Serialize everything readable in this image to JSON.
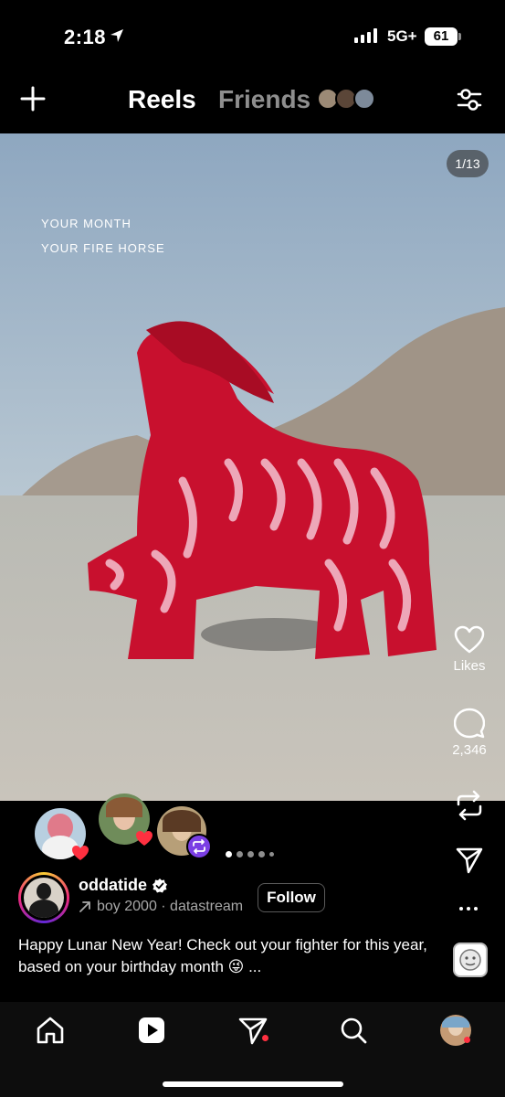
{
  "status_bar": {
    "time": "2:18",
    "network": "5G+",
    "battery": "61"
  },
  "header": {
    "tab_reels": "Reels",
    "tab_friends": "Friends",
    "icons": [
      "plus-icon",
      "filter-icon"
    ]
  },
  "media": {
    "overlay_line1": "YOUR  MONTH",
    "overlay_line2": "YOUR  FIRE  HORSE",
    "counter": "1/13"
  },
  "actions": {
    "likes_label": "Likes",
    "comments_count": "2,346"
  },
  "post": {
    "author": "oddatide",
    "audio": "boy 2000 · datastream",
    "follow_label": "Follow",
    "caption": "Happy Lunar New Year! Check out your fighter for this year, based on your birthday month 😜 ...",
    "carousel_dots": 5,
    "active_dot": 0
  },
  "nav": {
    "items": [
      "home-icon",
      "reels-icon",
      "messages-icon",
      "search-icon",
      "profile-avatar"
    ]
  },
  "colors": {
    "accent_red": "#ff3040",
    "muted": "#8e8e8e",
    "horse_red": "#c8102e",
    "repost_purple": "#7b3fe4"
  }
}
